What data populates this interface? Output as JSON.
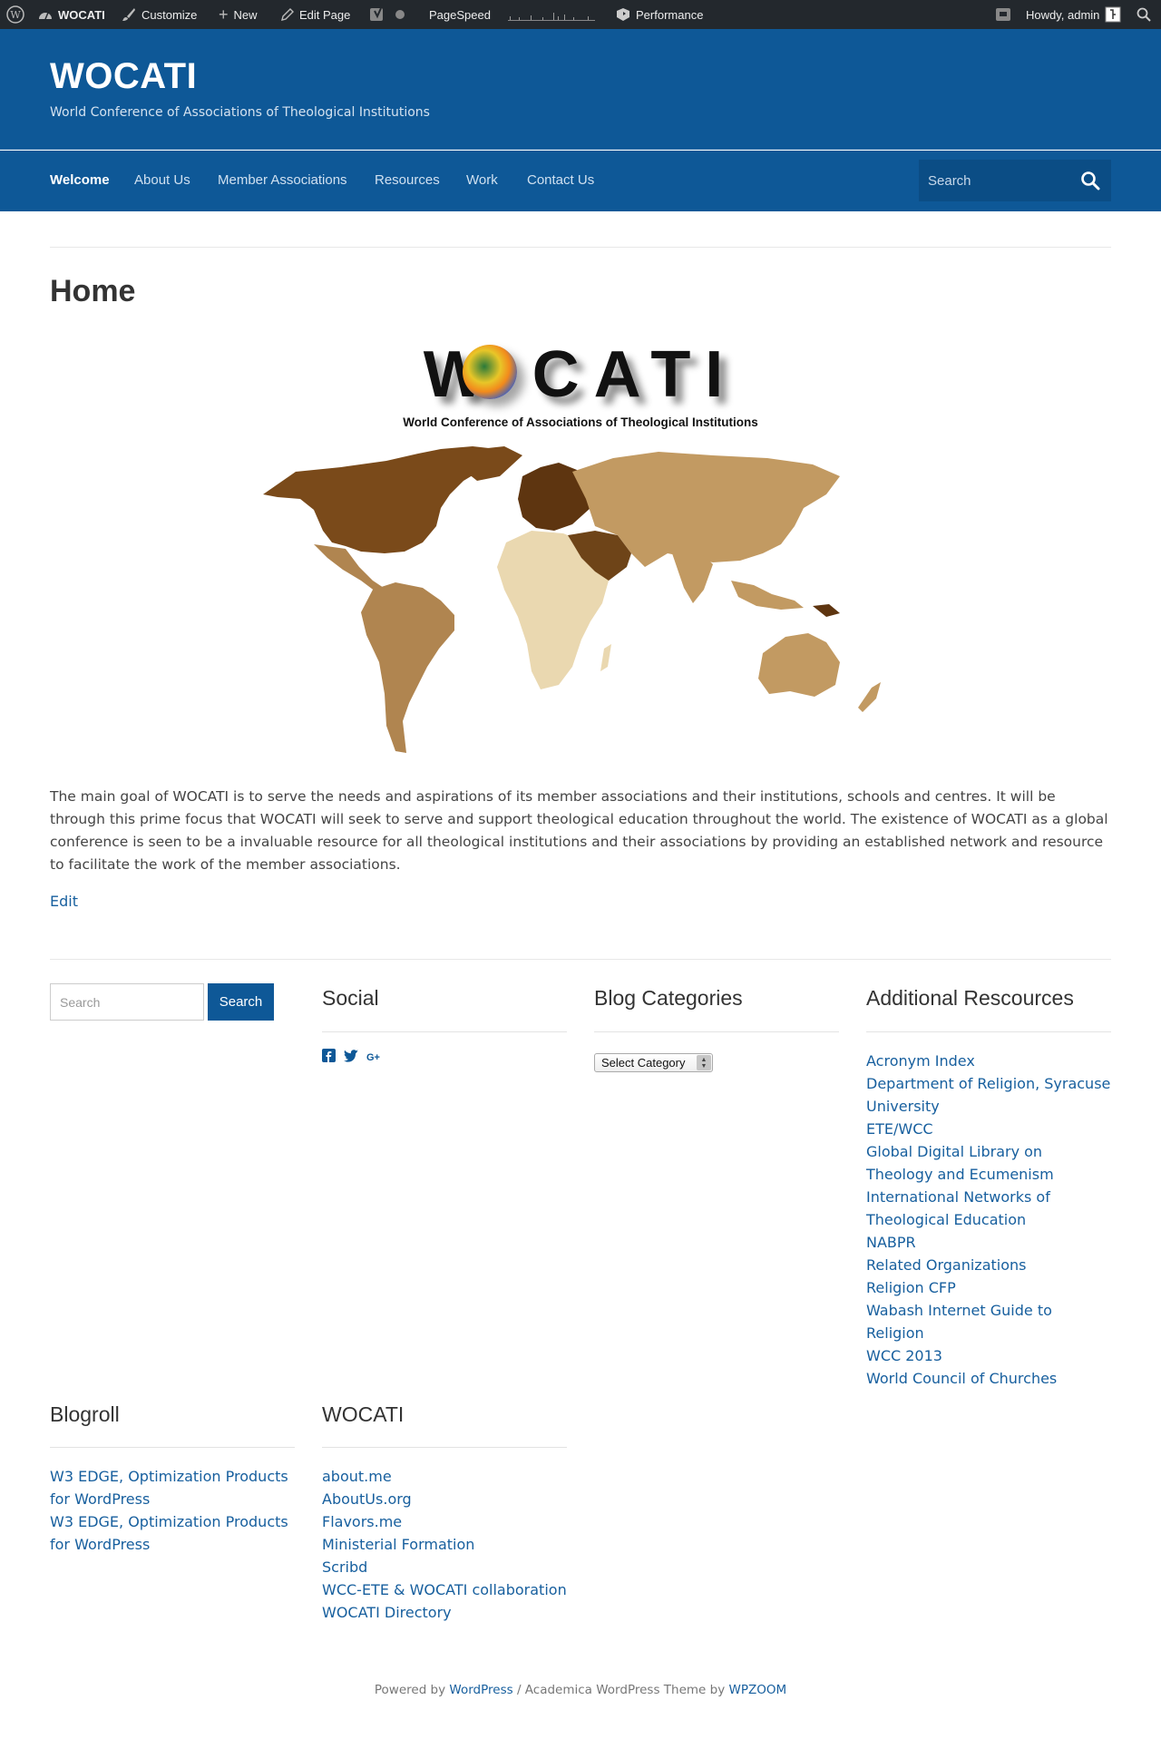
{
  "admin_bar": {
    "site_name": "WOCATI",
    "customize": "Customize",
    "new": "New",
    "edit_page": "Edit Page",
    "pagespeed": "PageSpeed",
    "performance": "Performance",
    "howdy": "Howdy, admin"
  },
  "header": {
    "site_title": "WOCATI",
    "tagline": "World Conference of Associations of Theological Institutions"
  },
  "nav": {
    "items": [
      "Welcome",
      "About Us",
      "Member Associations",
      "Resources",
      "Work",
      "Contact Us"
    ],
    "active": "Welcome",
    "search_placeholder": "Search"
  },
  "page": {
    "title": "Home",
    "logo_word": "W  CATI",
    "logo_subtitle": "World Conference of Associations of Theological Institutions",
    "intro": "The main goal of WOCATI is to serve the needs and aspirations of its member associations and their institutions, schools and centres. It will be through this prime focus that WOCATI will seek to serve and support theological education throughout the world. The existence of WOCATI as a global conference is seen to be a invaluable resource for all theological institutions and their associations by providing an established network and resource to facilitate the work of the member associations.",
    "edit_label": "Edit"
  },
  "widgets": {
    "search": {
      "placeholder": "Search",
      "button": "Search"
    },
    "social": {
      "title": "Social",
      "icons": [
        "facebook-icon",
        "twitter-icon",
        "google-plus-icon"
      ]
    },
    "blog_categories": {
      "title": "Blog Categories",
      "select_label": "Select Category"
    },
    "additional_resources": {
      "title": "Additional Rescources",
      "links": [
        "Acronym Index",
        "Department of Religion, Syracuse University",
        "ETE/WCC",
        "Global Digital Library on Theology and Ecumenism",
        "International Networks of Theological Education",
        "NABPR",
        "Related Organizations",
        "Religion CFP",
        "Wabash Internet Guide to Religion",
        "WCC 2013",
        "World Council of Churches"
      ]
    },
    "blogroll": {
      "title": "Blogroll",
      "links": [
        "W3 EDGE, Optimization Products for WordPress",
        "W3 EDGE, Optimization Products for WordPress"
      ]
    },
    "wocati": {
      "title": "WOCATI",
      "links": [
        "about.me",
        "AboutUs.org",
        "Flavors.me",
        "Ministerial Formation",
        "Scribd",
        "WCC-ETE & WOCATI collaboration",
        "WOCATI Directory"
      ]
    }
  },
  "footer": {
    "powered_by": "Powered by",
    "wordpress": "WordPress",
    "separator": " / Academica WordPress Theme by ",
    "wpzoom": "WPZOOM"
  },
  "colors": {
    "header_blue": "#0e5897",
    "link_blue": "#175f9e",
    "admin_bar": "#23282d"
  }
}
